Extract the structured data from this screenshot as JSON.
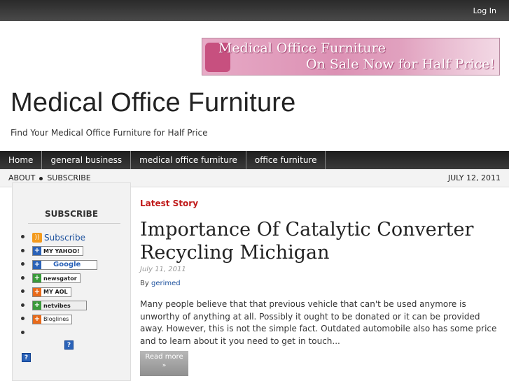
{
  "topbar": {
    "login": "Log In"
  },
  "banner": {
    "line1": "Medical Office Furniture",
    "line2": "On Sale Now for Half Price!"
  },
  "site": {
    "title": "Medical Office Furniture",
    "tagline": "Find Your Medical Office Furniture for Half Price"
  },
  "nav": {
    "items": [
      "Home",
      "general business",
      "medical office furniture",
      "office furniture"
    ]
  },
  "subnav": {
    "about": "ABOUT",
    "subscribe": "SUBSCRIBE",
    "date": "JULY 12, 2011"
  },
  "sidebar": {
    "title": "SUBSCRIBE",
    "subscribe_label": "Subscribe",
    "buttons": [
      {
        "label": "MY YAHOO!",
        "color": "#2a62b8"
      },
      {
        "label": "Google",
        "color": "#2a62b8"
      },
      {
        "label": "newsgator",
        "color": "#3a9a3a"
      },
      {
        "label": "MY AOL",
        "color": "#e86a1a"
      },
      {
        "label": "netvibes",
        "color": "#3a9a3a"
      },
      {
        "label": "Bloglines",
        "color": "#e86a1a"
      }
    ],
    "help": "?"
  },
  "post": {
    "section": "Latest Story",
    "title": "Importance Of Catalytic Converter Recycling Michigan",
    "date": "July 11, 2011",
    "by": "By",
    "author": "gerimed",
    "excerpt": "Many people believe that that previous vehicle that can't be used anymore is unworthy of anything at all. Possibly it ought to be donated or it can be provided away. However, this is not the simple fact. Outdated automobile also has some price and to learn about it you need to get in touch...",
    "read_more": "Read more",
    "read_more_arrow": "»"
  }
}
